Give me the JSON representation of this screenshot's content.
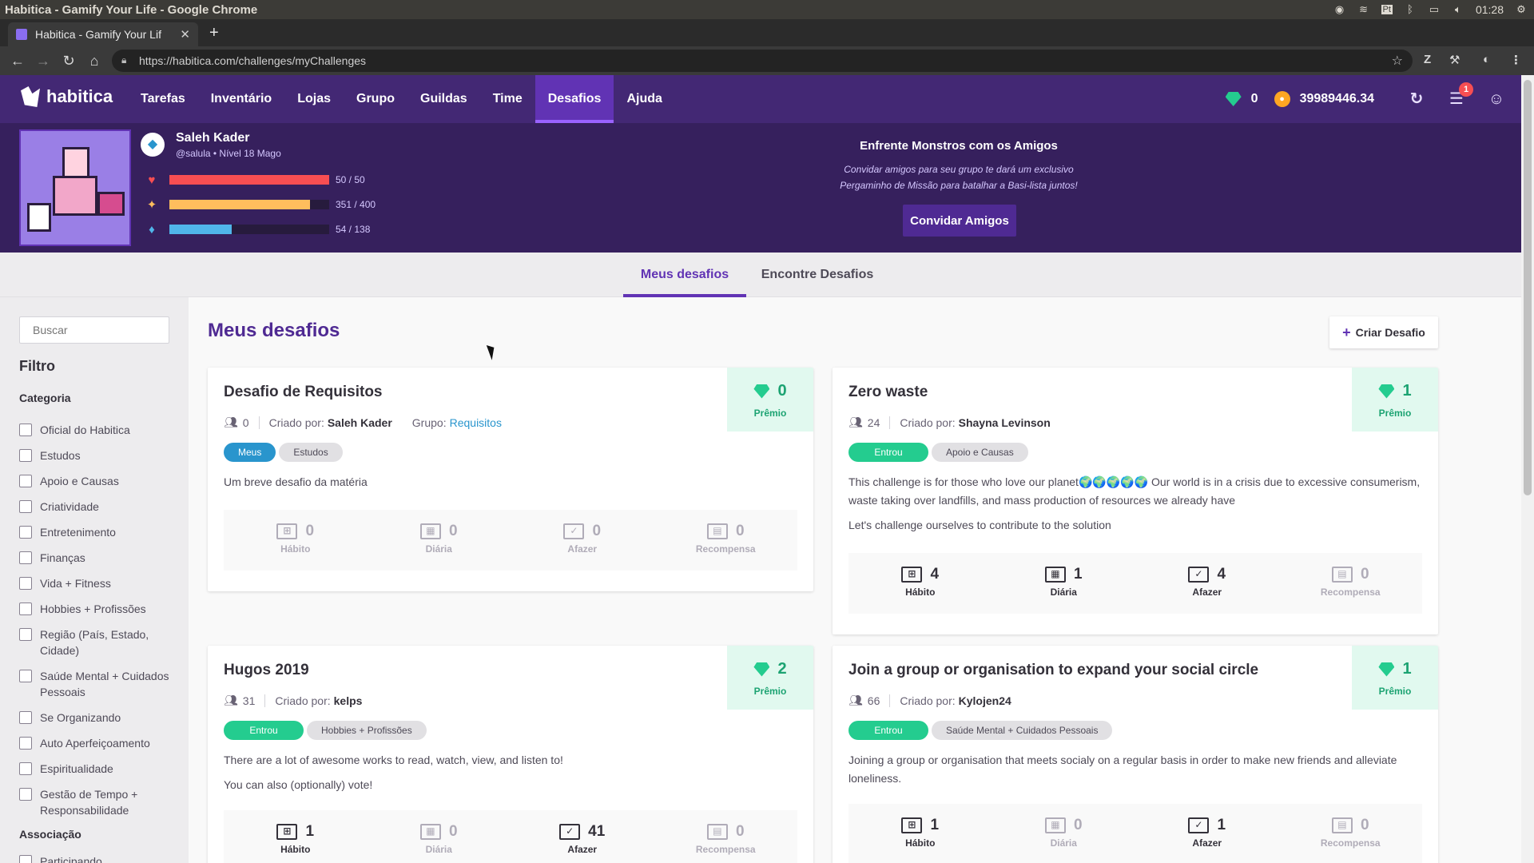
{
  "os": {
    "window_title": "Habitica - Gamify Your Life - Google Chrome",
    "lang": "Pt",
    "time": "01:28"
  },
  "browser": {
    "tab_title": "Habitica - Gamify Your Lif",
    "url": "https://habitica.com/challenges/myChallenges",
    "ext_z": "Z"
  },
  "nav": {
    "logo": "habitica",
    "items": [
      "Tarefas",
      "Inventário",
      "Lojas",
      "Grupo",
      "Guildas",
      "Time",
      "Desafios",
      "Ajuda"
    ],
    "active": "Desafios",
    "gems": "0",
    "gold": "39989446.34",
    "notifications": "1",
    "colors": {
      "bg": "#432874",
      "active": "#6133b4"
    }
  },
  "profile": {
    "name": "Saleh Kader",
    "info": "@salula • Nível 18 Mago",
    "hp": {
      "text": "50 / 50",
      "fraction": 1.0,
      "color": "#f74e52"
    },
    "xp": {
      "text": "351 / 400",
      "fraction": 0.8775,
      "color": "#ffbe5d"
    },
    "mp": {
      "text": "54 / 138",
      "fraction": 0.391,
      "color": "#50b5e9"
    }
  },
  "promo": {
    "title": "Enfrente Monstros com os Amigos",
    "line1": "Convidar amigos para seu grupo te dará um exclusivo",
    "line2": "Pergaminho de Missão para batalhar a Basi-lista juntos!",
    "button": "Convidar Amigos"
  },
  "subtabs": {
    "mine": "Meus desafios",
    "find": "Encontre Desafios"
  },
  "sidebar": {
    "search_placeholder": "Buscar",
    "filter": "Filtro",
    "category": "Categoria",
    "categories": [
      "Oficial do Habitica",
      "Estudos",
      "Apoio e Causas",
      "Criatividade",
      "Entretenimento",
      "Finanças",
      "Vida + Fitness",
      "Hobbies + Profissões",
      "Região (País, Estado, Cidade)",
      "Saúde Mental + Cuidados Pessoais",
      "Se Organizando",
      "Auto Aperfeiçoamento",
      "Espiritualidade",
      "Gestão de Tempo + Responsabilidade"
    ],
    "membership": "Associação",
    "membership_items": [
      "Participando"
    ]
  },
  "main": {
    "title": "Meus desafios",
    "create": "Criar Desafio",
    "labels": {
      "created_by": "Criado por:",
      "group": "Grupo:",
      "prize": "Prêmio",
      "habit": "Hábito",
      "daily": "Diária",
      "todo": "Afazer",
      "reward": "Recompensa"
    },
    "cards": [
      {
        "title": "Desafio de Requisitos",
        "members": "0",
        "creator": "Saleh Kader",
        "group": "Requisitos",
        "tags": [
          "Meus",
          "Estudos"
        ],
        "desc": [
          "Um breve desafio da matéria"
        ],
        "prize": "0",
        "counts": [
          "0",
          "0",
          "0",
          "0"
        ]
      },
      {
        "title": "Zero waste",
        "members": "24",
        "creator": "Shayna Levinson",
        "tags": [
          "Entrou",
          "Apoio e Causas"
        ],
        "desc": [
          "This challenge is for those who love our planet🌍🌍🌍🌍🌍 Our world is in a crisis due to excessive consumerism, waste taking over landfills, and mass production of resources we already have",
          "Let's challenge ourselves to contribute to the solution"
        ],
        "prize": "1",
        "counts": [
          "4",
          "1",
          "4",
          "0"
        ]
      },
      {
        "title": "Hugos 2019",
        "members": "31",
        "creator": "kelps",
        "tags": [
          "Entrou",
          "Hobbies + Profissões"
        ],
        "desc": [
          "There are a lot of awesome works to read, watch, view, and listen to!",
          "You can also (optionally) vote!"
        ],
        "prize": "2",
        "counts": [
          "1",
          "0",
          "41",
          "0"
        ]
      },
      {
        "title": "Join a group or organisation to expand your social circle",
        "members": "66",
        "creator": "Kylojen24",
        "tags": [
          "Entrou",
          "Saúde Mental + Cuidados Pessoais"
        ],
        "desc": [
          "Joining a group or organisation that meets socialy on a regular basis in order to make new friends and alleviate loneliness."
        ],
        "prize": "1",
        "counts": [
          "1",
          "0",
          "1",
          "0"
        ]
      }
    ]
  }
}
